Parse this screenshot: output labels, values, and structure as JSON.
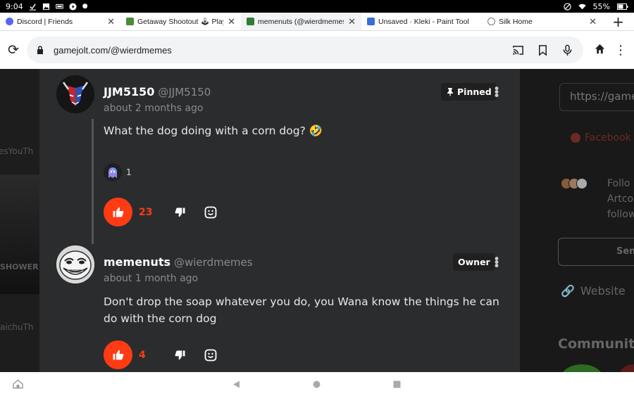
{
  "status_bar": {
    "time": "9:04",
    "battery": "55%"
  },
  "tabs": [
    {
      "title": "Discord | Friends",
      "color": "#5865f2"
    },
    {
      "title": "Getaway Shootout 🕹 Play G",
      "color": "#4a8a3a"
    },
    {
      "title": "memenuts (@wierdmemes)",
      "color": "#2f7d32",
      "active": true
    },
    {
      "title": "Unsaved · Kleki - Paint Tool",
      "color": "#3a6fd8"
    },
    {
      "title": "Silk Home",
      "color": "#777777"
    }
  ],
  "urlbar": {
    "url": "gamejolt.com/@wierdmemes"
  },
  "left_bg": {
    "text1": "esYouTh",
    "text2": "SHOWER",
    "text3": "aichuTh"
  },
  "right_panel": {
    "share_url": "https://game",
    "facebook": "Facebook",
    "follow_text": "Follo Artco follow",
    "button": "Sen",
    "website": "Website",
    "communities": "Communiti"
  },
  "comments": [
    {
      "name": "JJM5150",
      "handle": "@JJM5150",
      "time": "about 2 months ago",
      "badge": "Pinned",
      "text": "What the dog doing with a corn dog? 🤣",
      "reaction_count": "1",
      "likes": "23"
    },
    {
      "name": "memenuts",
      "handle": "@wierdmemes",
      "time": "about 1 month ago",
      "badge": "Owner",
      "text": "Don't drop the soap whatever you do, you Wana know the things he can do with the corn dog",
      "likes": "4"
    }
  ],
  "colors": {
    "accent": "#ff3b14",
    "panel": "#2b2c2e"
  }
}
